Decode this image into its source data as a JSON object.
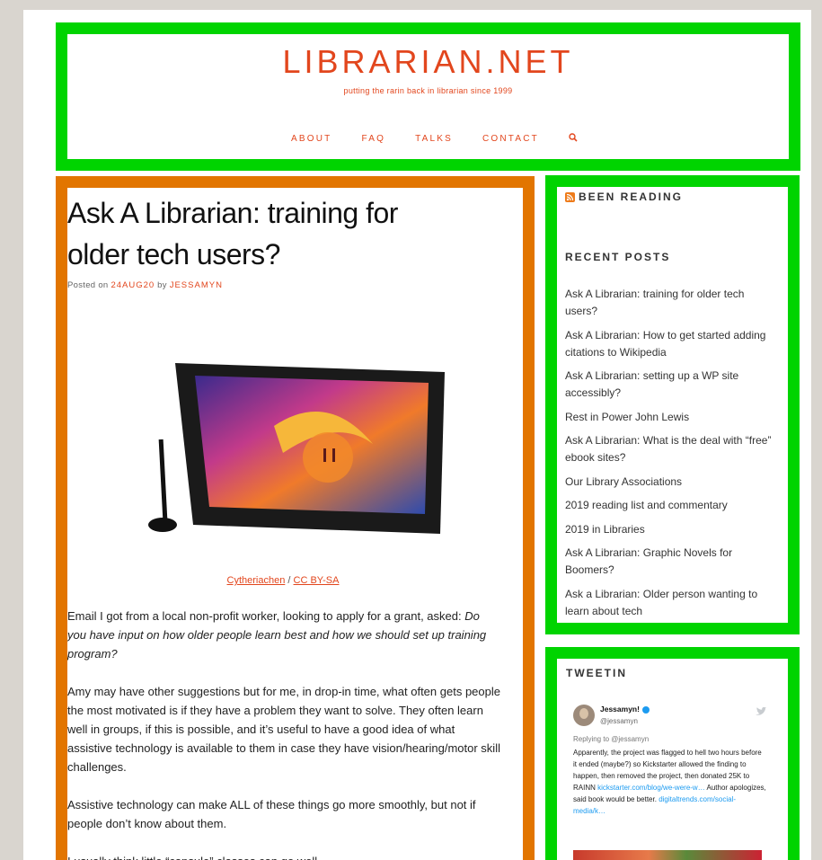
{
  "site": {
    "title": "LIBRARIAN.NET",
    "tagline": "putting the rarin back in librarian since 1999"
  },
  "nav": {
    "items": [
      "ABOUT",
      "FAQ",
      "TALKS",
      "CONTACT"
    ],
    "search_icon": "search-icon"
  },
  "post": {
    "title": "Ask A Librarian: training for older tech users?",
    "posted_on_label": "Posted on",
    "date": "24AUG20",
    "by_label": "by",
    "author": "JESSAMYN",
    "caption_author": "Cytheriachen",
    "caption_sep": "/",
    "caption_license": "CC BY-SA",
    "p1_plain": "Email I got from a local non-profit worker, looking to apply for a grant, asked: ",
    "p1_italic": "Do you have input on how older people learn best and how we should set up training program?",
    "p2": "Amy may have other suggestions but for me, in drop-in time, what often gets people the most motivated is if they have a problem they want to solve. They often learn well in groups, if this is possible, and it’s useful to have a good idea of what assistive technology is available to them in case they have vision/hearing/motor skill challenges.",
    "p3": "Assistive technology can make ALL of these things go more smoothly, but not if people don’t know about them.",
    "p4": "I usually think little “capsule” classes can go well"
  },
  "sidebar": {
    "been_reading_title": "BEEN READING",
    "recent_posts_title": "RECENT POSTS",
    "recent_posts": [
      "Ask A Librarian: training for older tech users?",
      "Ask A Librarian: How to get started adding citations to Wikipedia",
      "Ask A Librarian: setting up a WP site accessibly?",
      "Rest in Power John Lewis",
      "Ask A Librarian: What is the deal with “free” ebook sites?",
      "Our Library Associations",
      "2019 reading list and commentary",
      "2019 in Libraries",
      "Ask A Librarian: Graphic Novels for Boomers?",
      "Ask a Librarian: Older person wanting to learn about tech"
    ],
    "tweetin_title": "TWEETIN",
    "tweet": {
      "name": "Jessamyn!",
      "handle": "@jessamyn",
      "replying": "Replying to @jessamyn",
      "text": "Apparently, the project was flagged to hell two hours before it ended (maybe?) so Kickstarter allowed the finding to happen, then removed the project, then donated 25K to RAINN ",
      "link1": "kickstarter.com/blog/we-were-w…",
      "text2": " Author apologizes, said book would be better. ",
      "link2": "digitaltrends.com/social-media/k…"
    }
  },
  "colors": {
    "accent": "#e2461d",
    "header_border": "#00d400",
    "main_border": "#e27500"
  }
}
